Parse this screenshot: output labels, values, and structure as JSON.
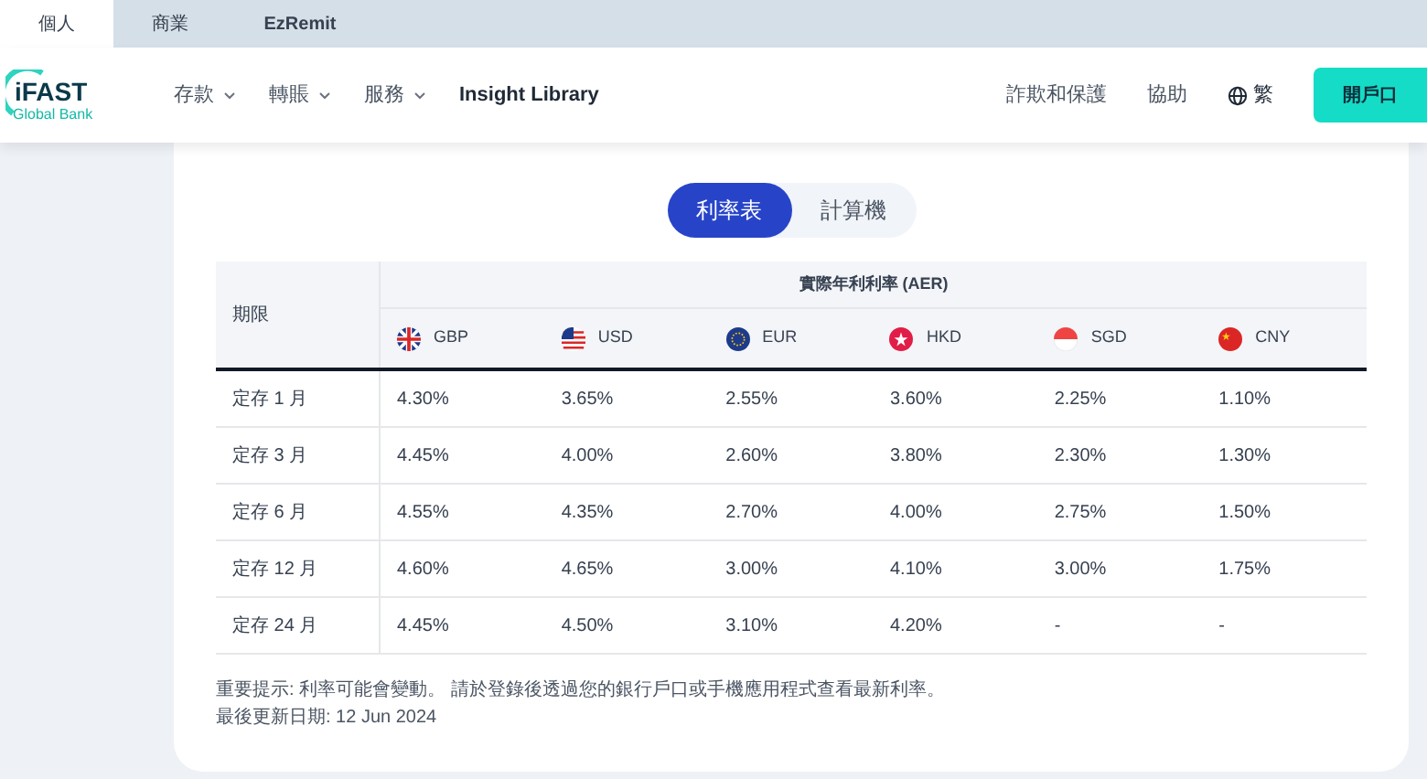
{
  "top_tabs": [
    {
      "label": "個人",
      "selected": true
    },
    {
      "label": "商業",
      "selected": false
    },
    {
      "label": "EzRemit",
      "selected": false
    }
  ],
  "logo": {
    "name": "iFAST",
    "subtitle": "Global Bank"
  },
  "nav": {
    "items": [
      {
        "label": "存款",
        "dropdown": true
      },
      {
        "label": "轉賬",
        "dropdown": true
      },
      {
        "label": "服務",
        "dropdown": true
      },
      {
        "label": "Insight Library",
        "dropdown": false
      }
    ],
    "links": [
      "詐欺和保護",
      "協助"
    ],
    "language": "繁",
    "cta": "開戶口"
  },
  "view_toggle": [
    {
      "label": "利率表",
      "selected": true
    },
    {
      "label": "計算機",
      "selected": false
    }
  ],
  "table": {
    "term_header": "期限",
    "group_header": "實際年利利率 (AER)",
    "currencies": [
      "GBP",
      "USD",
      "EUR",
      "HKD",
      "SGD",
      "CNY"
    ],
    "rows": [
      {
        "term": "定存 1 月",
        "rates": [
          "4.30%",
          "3.65%",
          "2.55%",
          "3.60%",
          "2.25%",
          "1.10%"
        ]
      },
      {
        "term": "定存 3 月",
        "rates": [
          "4.45%",
          "4.00%",
          "2.60%",
          "3.80%",
          "2.30%",
          "1.30%"
        ]
      },
      {
        "term": "定存 6 月",
        "rates": [
          "4.55%",
          "4.35%",
          "2.70%",
          "4.00%",
          "2.75%",
          "1.50%"
        ]
      },
      {
        "term": "定存 12 月",
        "rates": [
          "4.60%",
          "4.65%",
          "3.00%",
          "4.10%",
          "3.00%",
          "1.75%"
        ]
      },
      {
        "term": "定存 24 月",
        "rates": [
          "4.45%",
          "4.50%",
          "3.10%",
          "4.20%",
          "-",
          "-"
        ]
      }
    ]
  },
  "notes": [
    "重要提示: 利率可能會變動。 請於登錄後透過您的銀行戶口或手機應用程式查看最新利率。",
    "最後更新日期: 12 Jun 2024"
  ]
}
